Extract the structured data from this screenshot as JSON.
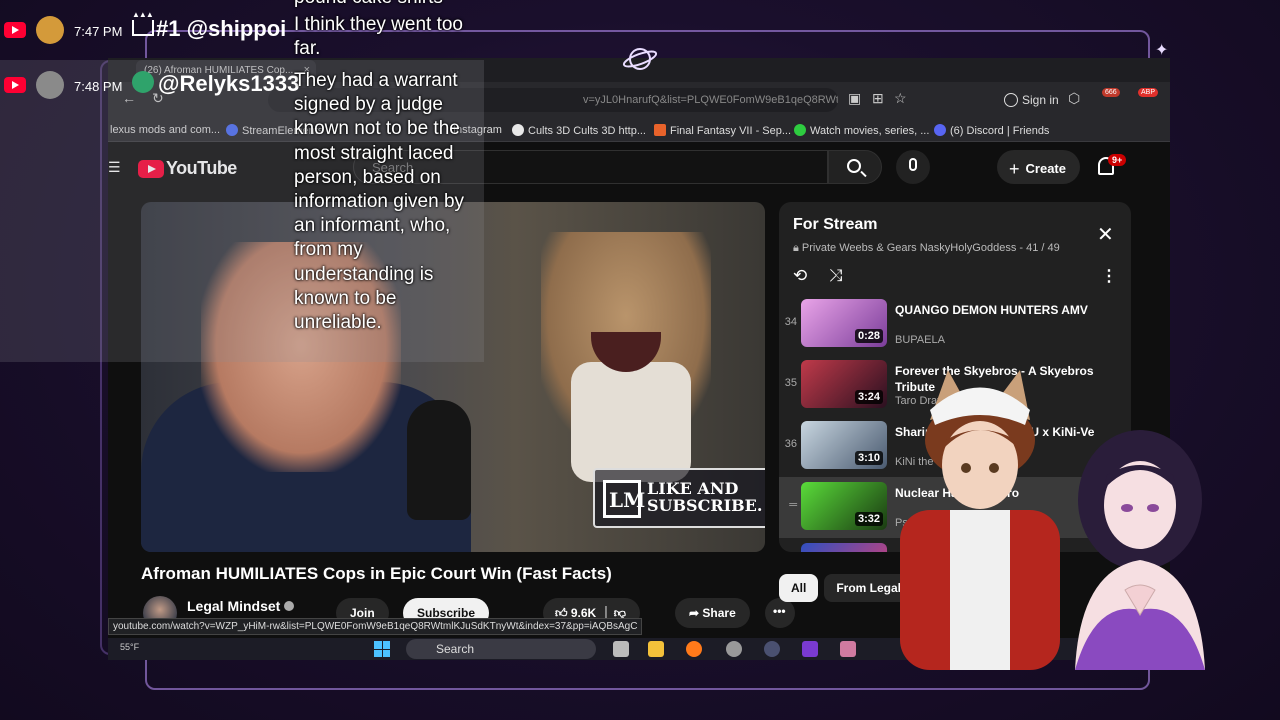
{
  "browser": {
    "tab_title": "(26) Afroman HUMILIATES Cop...",
    "url": "v=yJL0HnarufQ&list=PLQWE0FomW9eB1qeQ8RWtmlKJuSdKTnyWt&",
    "signin_label": "Sign in",
    "ext_badge_count": "666",
    "ext_abp": "ABP",
    "bookmarks": [
      {
        "label": "lexus mods and com...",
        "color": "#888"
      },
      {
        "label": "StreamElements",
        "color": "#4a6cf7"
      },
      {
        "label": "Instagram",
        "color": "#d62976"
      },
      {
        "label": "Cults 3D Cults 3D http...",
        "color": "#e8e8e8"
      },
      {
        "label": "Final Fantasy VII - Sep...",
        "color": "#e8632b"
      },
      {
        "label": "Watch movies, series, ...",
        "color": "#2ecc40"
      },
      {
        "label": "(6) Discord | Friends",
        "color": "#5865f2"
      }
    ],
    "status_url": "youtube.com/watch?v=WZP_yHiM-rw&list=PLQWE0FomW9eB1qeQ8RWtmlKJuSdKTnyWt&index=37&pp=iAQBsAgC"
  },
  "youtube": {
    "logo_text": "YouTube",
    "search_placeholder": "Search",
    "create_label": "Create",
    "notif_count": "9+",
    "video_title": "Afroman HUMILIATES Cops in Epic Court Win (Fast Facts)",
    "channel_name": "Legal Mindset",
    "join_label": "Join",
    "subscribe_label": "Subscribe",
    "likes": "9.6K",
    "share_label": "Share",
    "overlay_line1": "LIKE AND",
    "overlay_line2": "SUBSCRIBE.",
    "chips": [
      "All",
      "From Legal"
    ]
  },
  "playlist": {
    "title": "For Stream",
    "privacy": "Private",
    "owner": "Weebs & Gears NaskyHolyGoddess",
    "position": "41 / 49",
    "items": [
      {
        "index": "34",
        "title": "QUANGO DEMON HUNTERS AMV",
        "author": "BUPAELA",
        "duration": "0:28",
        "thumb": "#c27bc9"
      },
      {
        "index": "35",
        "title": "Forever the Skyebros - A Skyebros Tribute",
        "author": "Taro Dray",
        "duration": "3:24",
        "thumb": "#7a2b3a"
      },
      {
        "index": "36",
        "title": "Sharing the Skyebros CU x KiNi-Ve",
        "author": "KiNi the Ho",
        "duration": "3:10",
        "thumb": "#8aa0b0"
      },
      {
        "index": "",
        "title": "Nuclear Halo Skyebro",
        "author": "Psy",
        "duration": "3:32",
        "thumb": "#2e7a2a"
      },
      {
        "index": "",
        "title": "",
        "author": "",
        "duration": "",
        "thumb": "#3050c0"
      }
    ]
  },
  "taskbar": {
    "temp": "55°F",
    "search_label": "Search"
  },
  "chat": {
    "entries": [
      {
        "time": "7:47 PM",
        "user": "#1 @shippoi",
        "avatar_color": "#d49a3a"
      },
      {
        "time": "7:48 PM",
        "user": "@Relyks1333",
        "avatar_color": "#8a8a8a"
      }
    ],
    "message_top_fragment": "pound cake shirts",
    "message_mid": "I think they went too far.",
    "message_main": "They had a warrant signed by a judge known not to be the most straight laced person, based on information given by an informant, who, from my understanding is known to be unreliable."
  }
}
